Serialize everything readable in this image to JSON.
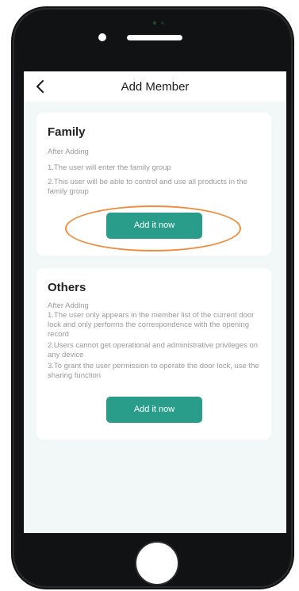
{
  "header": {
    "title": "Add Member"
  },
  "family": {
    "title": "Family",
    "after_label": "After Adding",
    "lines": [
      "1.The user will enter the family group",
      "2.This user will be able to control and use all products in the family group"
    ],
    "button_label": "Add it now"
  },
  "others": {
    "title": "Others",
    "after_label": "After Adding",
    "lines": [
      "1.The user only appears in the member list of the current door lock and only performs the correspondence with the opening record",
      "2.Users cannot get operational and administrative privileges on any device",
      "3.To grant the user permission to operate the door lock, use the sharing function"
    ],
    "button_label": "Add it now"
  },
  "colors": {
    "accent": "#2a9d8a",
    "highlight": "#ee8d3e",
    "background": "#f2f7f7"
  },
  "icons": {
    "back": "chevron-left-icon"
  }
}
